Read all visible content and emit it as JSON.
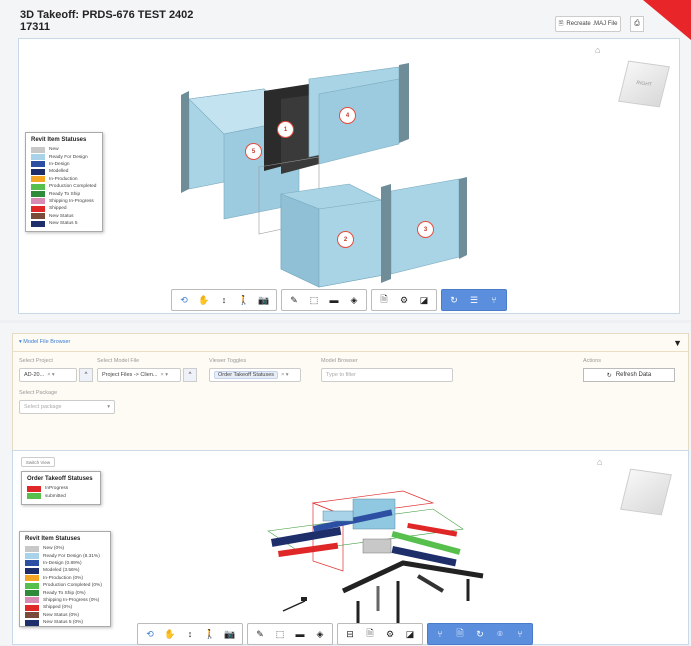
{
  "top": {
    "title_line1": "3D Takeoff: PRDS-676 TEST 2402",
    "title_line2": "17311",
    "recreate_label": "Recreate .MAJ File",
    "cube_label": "RIGHT",
    "legend": {
      "title": "Revit Item Statuses",
      "items": [
        {
          "label": "New",
          "color": "#c8c8c8"
        },
        {
          "label": "Ready For Design",
          "color": "#a9d3e8"
        },
        {
          "label": "In-Design",
          "color": "#2c4fa3"
        },
        {
          "label": "Modelled",
          "color": "#1e2e6b"
        },
        {
          "label": "In-Production",
          "color": "#f5a623"
        },
        {
          "label": "Production Completed",
          "color": "#57c04d"
        },
        {
          "label": "Ready To Ship",
          "color": "#2e8b3a"
        },
        {
          "label": "Shipping In-Progress",
          "color": "#d98cb3"
        },
        {
          "label": "Shipped",
          "color": "#e02727"
        },
        {
          "label": "New Status",
          "color": "#7a4b3a"
        },
        {
          "label": "New Status 5",
          "color": "#1e2e6b"
        }
      ]
    },
    "markers": [
      "1",
      "2",
      "3",
      "4",
      "5"
    ]
  },
  "browser": {
    "header": "Model File Browser",
    "select_project_label": "Select Project",
    "select_project_value": "AD-20...",
    "select_model_label": "Select Model File",
    "select_model_value": "Project Files -> Clien...",
    "viewer_toggles_label": "Viewer Toggles",
    "viewer_toggles_chip": "Order Takeoff Statuses",
    "model_browser_label": "Model Browser",
    "model_browser_placeholder": "Type to filter",
    "actions_label": "Actions",
    "refresh_label": "Refresh Data",
    "select_package_label": "Select Package",
    "select_package_placeholder": "Select package"
  },
  "bottom": {
    "switch_view": "Switch View",
    "order_legend": {
      "title": "Order Takeoff Statuses",
      "items": [
        {
          "label": "InProgress",
          "color": "#e02727"
        },
        {
          "label": "submitted",
          "color": "#57c04d"
        }
      ]
    },
    "revit_legend": {
      "title": "Revit Item Statuses",
      "items": [
        {
          "label": "New (0%)",
          "color": "#c8c8c8"
        },
        {
          "label": "Ready For Design (8.31%)",
          "color": "#a9d3e8"
        },
        {
          "label": "In-Design (0.89%)",
          "color": "#2c4fa3"
        },
        {
          "label": "Modeled (3.56%)",
          "color": "#1e2e6b"
        },
        {
          "label": "In-Production (0%)",
          "color": "#f5a623"
        },
        {
          "label": "Production Completed (0%)",
          "color": "#57c04d"
        },
        {
          "label": "Ready To Ship (0%)",
          "color": "#2e8b3a"
        },
        {
          "label": "Shipping In-Progress (0%)",
          "color": "#d98cb3"
        },
        {
          "label": "Shipped (0%)",
          "color": "#e02727"
        },
        {
          "label": "New Status (0%)",
          "color": "#7a4b3a"
        },
        {
          "label": "New Status 5 (0%)",
          "color": "#1e2e6b"
        }
      ]
    }
  },
  "icons": {
    "orbit": "⟲",
    "pan": "✋",
    "zoom": "↕",
    "walk": "🚶",
    "camera": "📷",
    "measure": "📏",
    "explode": "⬚",
    "folder": "▬",
    "model": "◈",
    "tree": "⊟",
    "doc": "🗎",
    "settings": "⚙",
    "fullscreen": "◪",
    "sync": "↻",
    "list": "☰",
    "branch": "⑂"
  }
}
